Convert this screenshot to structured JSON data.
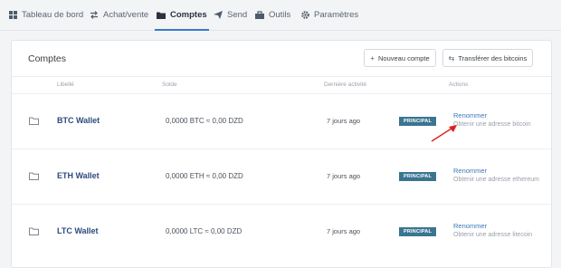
{
  "nav": {
    "items": [
      {
        "label": "Tableau de bord",
        "icon": "dashboard-icon"
      },
      {
        "label": "Achat/vente",
        "icon": "exchange-icon"
      },
      {
        "label": "Comptes",
        "icon": "folder-icon",
        "active": true
      },
      {
        "label": "Send",
        "icon": "send-icon"
      },
      {
        "label": "Outils",
        "icon": "toolbox-icon"
      },
      {
        "label": "Paramètres",
        "icon": "gear-icon"
      }
    ]
  },
  "accounts_panel": {
    "title": "Comptes",
    "new_account_label": "Nouveau compte",
    "transfer_label": "Transférer des bitcoins",
    "columns": {
      "label": "Libellé",
      "balance": "Solde",
      "last_activity": "Dernière activité",
      "actions": "Actions"
    },
    "rows": [
      {
        "name": "BTC Wallet",
        "balance": "0,0000 BTC ≈ 0,00 DZD",
        "last_activity": "7 jours ago",
        "badge": "PRINCIPAL",
        "rename": "Renommer",
        "address": "Obtenir une adresse bitcoin"
      },
      {
        "name": "ETH Wallet",
        "balance": "0,0000 ETH ≈ 0,00 DZD",
        "last_activity": "7 jours ago",
        "badge": "PRINCIPAL",
        "rename": "Renommer",
        "address": "Obtenir une adresse ethereum"
      },
      {
        "name": "LTC Wallet",
        "balance": "0,0000 LTC ≈ 0,00 DZD",
        "last_activity": "7 jours ago",
        "badge": "PRINCIPAL",
        "rename": "Renommer",
        "address": "Obtenir une adresse litecoin"
      }
    ]
  },
  "colors": {
    "accent": "#3878c7",
    "badge": "#3a7590",
    "link": "#3d78b8",
    "annotation_arrow": "#e02020"
  }
}
